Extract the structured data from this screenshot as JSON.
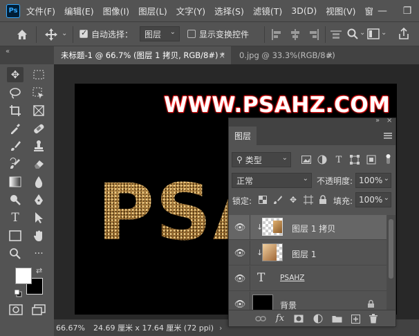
{
  "menu": {
    "logo": "Ps",
    "items": [
      "文件(F)",
      "编辑(E)",
      "图像(I)",
      "图层(L)",
      "文字(Y)",
      "选择(S)",
      "滤镜(T)",
      "3D(D)",
      "视图(V)",
      "窗"
    ],
    "minimize": "—",
    "restore": "❐"
  },
  "options": {
    "auto_select_label": "自动选择：",
    "auto_select_checked": true,
    "target_value": "图层",
    "show_transform_label": "显示变换控件",
    "show_transform_checked": false
  },
  "tabs": [
    {
      "label": "未标题-1 @ 66.7% (图层 1 拷贝, RGB/8#) *",
      "close": "×",
      "active": true
    },
    {
      "label": "0.jpg @ 33.3%(RGB/8#)",
      "close": "×",
      "active": false
    }
  ],
  "canvas": {
    "watermark": "WWW.PSAHZ.COM",
    "big_text": "PSAHZ"
  },
  "status": {
    "zoom": "66.67%",
    "doc_size": "24.69 厘米 x 17.64 厘米 (72 ppi)",
    "arrow": "›"
  },
  "layers_panel": {
    "tab_label": "图层",
    "filter_label": "类型",
    "blend_mode": "正常",
    "opacity_label": "不透明度:",
    "opacity_value": "100%",
    "lock_label": "锁定:",
    "fill_label": "填充:",
    "fill_value": "100%",
    "layers": [
      {
        "name": "图层 1 拷贝",
        "selected": true,
        "clipped": true,
        "kind": "pixel-check"
      },
      {
        "name": "图层 1",
        "selected": false,
        "clipped": true,
        "kind": "pixel-photo"
      },
      {
        "name": "PSAHZ",
        "selected": false,
        "clipped": false,
        "kind": "text"
      },
      {
        "name": "背景",
        "selected": false,
        "clipped": false,
        "kind": "background"
      }
    ],
    "type_thumb_glyph": "T"
  },
  "colors": {
    "app_bg": "#535353",
    "panel_dark": "#424242",
    "pasteboard": "#282828",
    "selected_layer": "#666666",
    "watermark_glow": "#ff2222",
    "gold": "#b88a46"
  }
}
